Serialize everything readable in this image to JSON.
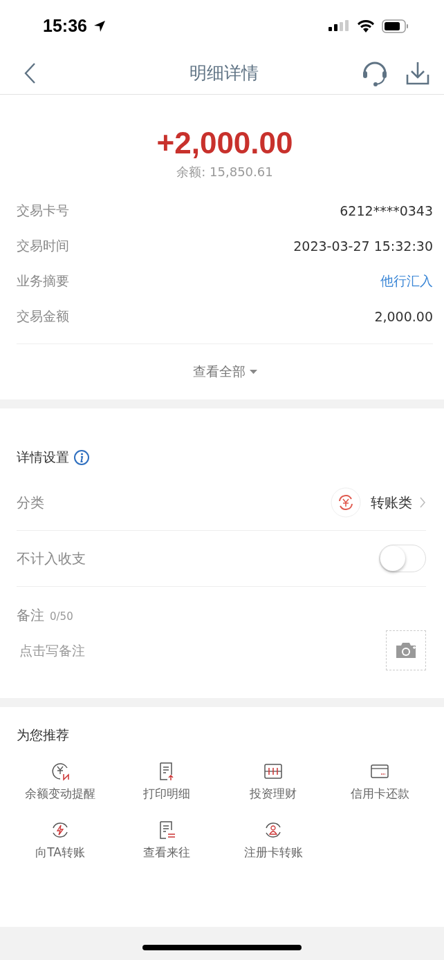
{
  "status_bar": {
    "time": "15:36"
  },
  "nav": {
    "title": "明细详情"
  },
  "summary": {
    "amount": "+2,000.00",
    "balance": "余额: 15,850.61"
  },
  "details": [
    {
      "label": "交易卡号",
      "value": "6212****0343",
      "kind": "plain"
    },
    {
      "label": "交易时间",
      "value": "2023-03-27 15:32:30",
      "kind": "plain"
    },
    {
      "label": "业务摘要",
      "value": "他行汇入",
      "kind": "link"
    },
    {
      "label": "交易金额",
      "value": "2,000.00",
      "kind": "plain"
    }
  ],
  "view_all": "查看全部",
  "settings": {
    "title": "详情设置",
    "category_label": "分类",
    "category_value": "转账类",
    "exclude_label": "不计入收支",
    "exclude_on": false,
    "note_label": "备注",
    "note_count": "0/50",
    "note_placeholder": "点击写备注"
  },
  "recommend": {
    "title": "为您推荐",
    "items": [
      {
        "label": "余额变动提醒",
        "kind": "alert"
      },
      {
        "label": "打印明细",
        "kind": "print"
      },
      {
        "label": "投资理财",
        "kind": "invest"
      },
      {
        "label": "信用卡还款",
        "kind": "card"
      },
      {
        "label": "向TA转账",
        "kind": "transfer"
      },
      {
        "label": "查看来往",
        "kind": "history"
      },
      {
        "label": "注册卡转账",
        "kind": "user"
      }
    ]
  }
}
